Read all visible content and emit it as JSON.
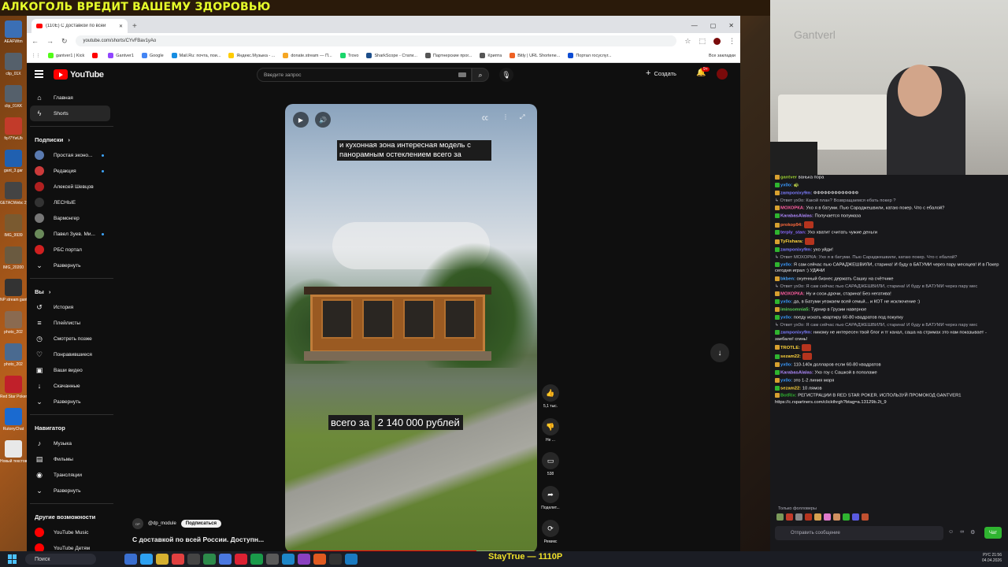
{
  "overlay": {
    "banner": "АЛКОГОЛЬ ВРЕДИТ ВАШЕМУ ЗДОРОВЬЮ",
    "ticker": "StayTrue — 1110P"
  },
  "desktop_icons": [
    {
      "label": "AEAFWtm",
      "color": "#3b6fb5"
    },
    {
      "label": "clip_01X",
      "color": "#55606b"
    },
    {
      "label": "clip_01KK",
      "color": "#55606b"
    },
    {
      "label": "fq-f7YwUb",
      "color": "#c23b2a"
    },
    {
      "label": "gant_3.gar",
      "color": "#2060b0"
    },
    {
      "label": "GETACWebc 2_gantver",
      "color": "#444"
    },
    {
      "label": "IMG_9939",
      "color": "#7a5a30"
    },
    {
      "label": "IMG_20200",
      "color": "#6a5a40"
    },
    {
      "label": "NP stream gantver1",
      "color": "#333"
    },
    {
      "label": "photo_202",
      "color": "#8a6a50"
    },
    {
      "label": "photo_202",
      "color": "#4a6a90"
    },
    {
      "label": "Red Star Poker",
      "color": "#c0202a"
    },
    {
      "label": "RutonyChat",
      "color": "#1a6ad0"
    },
    {
      "label": "Новый текстовый",
      "color": "#e8e8e8"
    }
  ],
  "browser": {
    "tab_title": "(110E) С доставкой по всей",
    "url": "youtube.com/shorts/CYvFBav1yAo",
    "bookmarks": [
      {
        "label": "gantver1 | Kick",
        "color": "#53fc18"
      },
      {
        "label": "",
        "color": "#ff0000"
      },
      {
        "label": "Gantver1",
        "color": "#9146ff"
      },
      {
        "label": "Google",
        "color": "#4285f4"
      },
      {
        "label": "Mail.Ru: почта, пои...",
        "color": "#168de2"
      },
      {
        "label": "Яндекс.Музыка - ...",
        "color": "#ffcc00"
      },
      {
        "label": "donate.stream — П...",
        "color": "#f5a623"
      },
      {
        "label": "Trovo",
        "color": "#19d66b"
      },
      {
        "label": "SharkScope - Стати...",
        "color": "#1c4e8a"
      },
      {
        "label": "Партнерские прог...",
        "color": "#555"
      },
      {
        "label": "Крипта",
        "color": "#555"
      },
      {
        "label": "Bitly | URL Shortene...",
        "color": "#ee6123"
      },
      {
        "label": "Портал госуслуг...",
        "color": "#0d4cd3"
      }
    ],
    "bookmarks_all": "Все закладки"
  },
  "youtube": {
    "logo": "YouTube",
    "search_placeholder": "Введите запрос",
    "create_label": "Создать",
    "bell_badge": "9+",
    "sidebar": {
      "main": [
        {
          "label": "Главная",
          "icon": "home-icon",
          "glyph": "⌂"
        },
        {
          "label": "Shorts",
          "icon": "shorts-icon",
          "glyph": "ϟ"
        }
      ],
      "subs_head": "Подписки",
      "subs": [
        {
          "label": "Простая эконо...",
          "color": "#5a7ab0",
          "dot": true
        },
        {
          "label": "Редакция",
          "color": "#cc3a3a",
          "dot": true
        },
        {
          "label": "Алексей Шевцов",
          "color": "#b02020",
          "dot": false
        },
        {
          "label": "ЛЕСНЫЕ",
          "color": "#333333",
          "dot": false
        },
        {
          "label": "Вармонгер",
          "color": "#777777",
          "dot": false
        },
        {
          "label": "Павел Зуев. Ми...",
          "color": "#6a8a5a",
          "dot": true
        },
        {
          "label": "РБС портал",
          "color": "#d02020",
          "dot": false
        }
      ],
      "subs_expand": "Развернуть",
      "you_head": "Вы",
      "you": [
        {
          "label": "История",
          "glyph": "↺"
        },
        {
          "label": "Плейлисты",
          "glyph": "≡"
        },
        {
          "label": "Смотреть позже",
          "glyph": "◷"
        },
        {
          "label": "Понравившиеся",
          "glyph": "♡"
        },
        {
          "label": "Ваши видео",
          "glyph": "▣"
        },
        {
          "label": "Скачанные",
          "glyph": "↓"
        },
        {
          "label": "Развернуть",
          "glyph": "⌄"
        }
      ],
      "nav_head": "Навигатор",
      "nav": [
        {
          "label": "Музыка",
          "glyph": "♪"
        },
        {
          "label": "Фильмы",
          "glyph": "▤"
        },
        {
          "label": "Трансляции",
          "glyph": "◉"
        },
        {
          "label": "Развернуть",
          "glyph": "⌄"
        }
      ],
      "more_head": "Другие возможности",
      "more": [
        {
          "label": "YouTube Music",
          "color": "#ff0000"
        },
        {
          "label": "YouTube Детям",
          "color": "#ff0000"
        }
      ]
    },
    "short": {
      "caption_top": "и кухонная зона интересная модель с панорамным остеклением всего за",
      "caption_price_prefix": "всего за",
      "caption_price": "2 140 000 рублей",
      "progress": 0.76,
      "channel_avatar": "DP",
      "channel": "@dp_module",
      "subscribe": "Подписаться",
      "title": "С доставкой по всей России. Доступн..."
    },
    "actions": [
      {
        "name": "like",
        "glyph": "👍",
        "label": "5,1 тыс."
      },
      {
        "name": "dislike",
        "glyph": "👎",
        "label": "Не ..."
      },
      {
        "name": "comments",
        "glyph": "▭",
        "label": "538"
      },
      {
        "name": "share",
        "glyph": "➦",
        "label": "Поделит..."
      },
      {
        "name": "remix",
        "glyph": "⟳",
        "label": "Ремикс"
      },
      {
        "name": "channel",
        "glyph": "DP",
        "label": ""
      }
    ]
  },
  "stream_chat": {
    "messages": [
      {
        "name": "gantver",
        "color": "#9acd32",
        "text": "ванька пора",
        "reply": false
      },
      {
        "name": "yx0o:",
        "color": "#3a9bff",
        "text": "🐢",
        "reply": false
      },
      {
        "name": "zamponixy9m:",
        "color": "#7c7cff",
        "text": "ФФФФФФФФФФФФФ",
        "reply": false
      },
      {
        "name": "",
        "color": "#adadb8",
        "text": "↳ Ответ yx0o: Какой план? Возвращаемся ебать покер ?",
        "reply": true
      },
      {
        "name": "МОХОРКА:",
        "color": "#ff5ea0",
        "text": "Ухо я в батуми. Пью Сараджешвили, катаю покер. Что с ебалой?",
        "reply": false
      },
      {
        "name": "KarabasAlalas:",
        "color": "#b08aff",
        "text": "Получается полумаза",
        "reply": false
      },
      {
        "name": "prokop94:",
        "color": "#ff6a3d",
        "text": "",
        "emote": true,
        "reply": false
      },
      {
        "name": "terply_stan:",
        "color": "#8a6aff",
        "text": "Ухо хватит считать чужие деньги",
        "reply": false
      },
      {
        "name": "TyFishara:",
        "color": "#ffd43b",
        "text": "",
        "emote": true,
        "reply": false
      },
      {
        "name": "zamponixy9m:",
        "color": "#7c7cff",
        "text": "ухо уйди!",
        "reply": false
      },
      {
        "name": "",
        "color": "#adadb8",
        "text": "↳ Ответ МОХОРКА: Ухо я в батуми. Пью Сараджешвили, катаю покер. Что с ебалой?",
        "reply": true
      },
      {
        "name": "yx0o:",
        "color": "#3a9bff",
        "text": "Я сам сейчас пью САРАДЖЕШВИЛИ, старина! И буду в БАТУМИ через пару месяцев! И в Покер сегодня играл :) УДАЧИ",
        "reply": false
      },
      {
        "name": "bkben:",
        "color": "#4aa8ff",
        "text": "охуенный бизнес держать Сашку на счётчике",
        "reply": false
      },
      {
        "name": "",
        "color": "#adadb8",
        "text": "↳ Ответ yx0o: Я сам сейчас пью САРАДЖЕШВИЛИ, старина! И буду в БАТУМИ через пару мес",
        "reply": true
      },
      {
        "name": "МОХОРКА:",
        "color": "#ff5ea0",
        "text": "Ну и соси-дрочи, старина! Без негатива!",
        "reply": false
      },
      {
        "name": "yx0o:",
        "color": "#3a9bff",
        "text": "да, в Батуми уезжаем всей семьй... и КОТ не исключение :)",
        "reply": false
      },
      {
        "name": "iminsomnia5:",
        "color": "#5ad35a",
        "text": "Турнир в Грузии наверное",
        "reply": false
      },
      {
        "name": "yx0o:",
        "color": "#3a9bff",
        "text": "поеду искать квартиру 60-80 квадратов под покупку",
        "reply": false
      },
      {
        "name": "",
        "color": "#adadb8",
        "text": "↳ Ответ yx0o: Я сам сейчас пью САРАДЖЕШВИЛИ, старина! И буду в БАТУМИ через пару мес",
        "reply": true
      },
      {
        "name": "zamponixy9m:",
        "color": "#7c7cff",
        "text": "никому не интересен твой блог и тг канал, саша на стримах это нам показывает - заебало! сгинь!",
        "reply": false
      },
      {
        "name": "TROTLE:",
        "color": "#ffd43b",
        "text": "",
        "emote": true,
        "reply": false
      },
      {
        "name": "sezam22:",
        "color": "#ffd43b",
        "text": "",
        "emote": true,
        "reply": false
      },
      {
        "name": "yx0o:",
        "color": "#3a9bff",
        "text": "110-140к долларов если 60-80 квадратов",
        "reply": false
      },
      {
        "name": "KarabasAlalas:",
        "color": "#b08aff",
        "text": "Ухо гоу с Сашкой в пополаме",
        "reply": false
      },
      {
        "name": "yx0o:",
        "color": "#3a9bff",
        "text": "это 1-2 линия моря",
        "reply": false
      },
      {
        "name": "sezam22:",
        "color": "#ffd43b",
        "text": "10 лямов",
        "reply": false
      },
      {
        "name": "BotRix:",
        "color": "#2fb430",
        "text": "РЕГИСТРАЦИИ В RED STAR POKER. ИСПОЛЬЗУЙ ПРОМОКОД GANTVER1 https://c.rspartners.com/clickthrgh?btag=a.13129b.2t_9",
        "reply": false
      }
    ],
    "followers_only": "Только фолловеры",
    "input_placeholder": "Отправить сообщение",
    "send_label": "Чат"
  },
  "taskbar": {
    "search_label": "Поиск",
    "tray_time": "21:56",
    "tray_date": "04.04.2026",
    "tray_lang": "РУС"
  }
}
